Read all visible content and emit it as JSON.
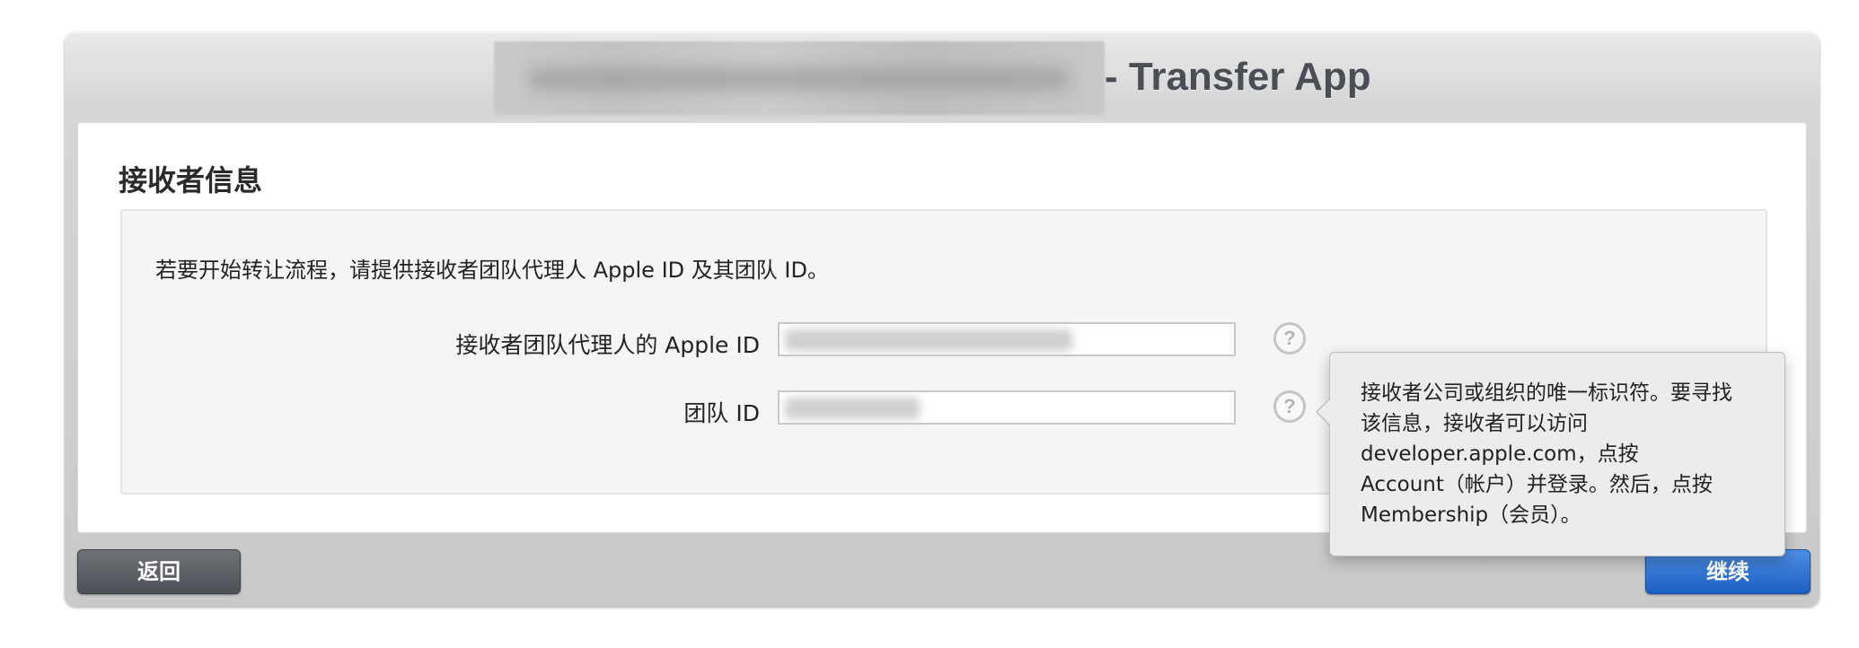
{
  "window": {
    "title_suffix": "- Transfer App"
  },
  "panel": {
    "section_title": "接收者信息",
    "intro_text": "若要开始转让流程，请提供接收者团队代理人 Apple ID 及其团队 ID。",
    "fields": {
      "apple_id_label": "接收者团队代理人的 Apple ID",
      "team_id_label": "团队 ID",
      "help_glyph": "?"
    }
  },
  "tooltip": {
    "lines": [
      "接收者公司或组织的唯一标识符。要寻找",
      "该信息，接收者可以访问",
      "developer.apple.com，点按",
      "Account（帐户）并登录。然后，点按",
      "Membership（会员）。"
    ]
  },
  "buttons": {
    "back_label": "返回",
    "continue_label": "继续"
  },
  "colors": {
    "title_text": "#4a4f56",
    "back_button": "#5c6066",
    "continue_button": "#2f6fd0",
    "tooltip_bg": "#ececec"
  }
}
